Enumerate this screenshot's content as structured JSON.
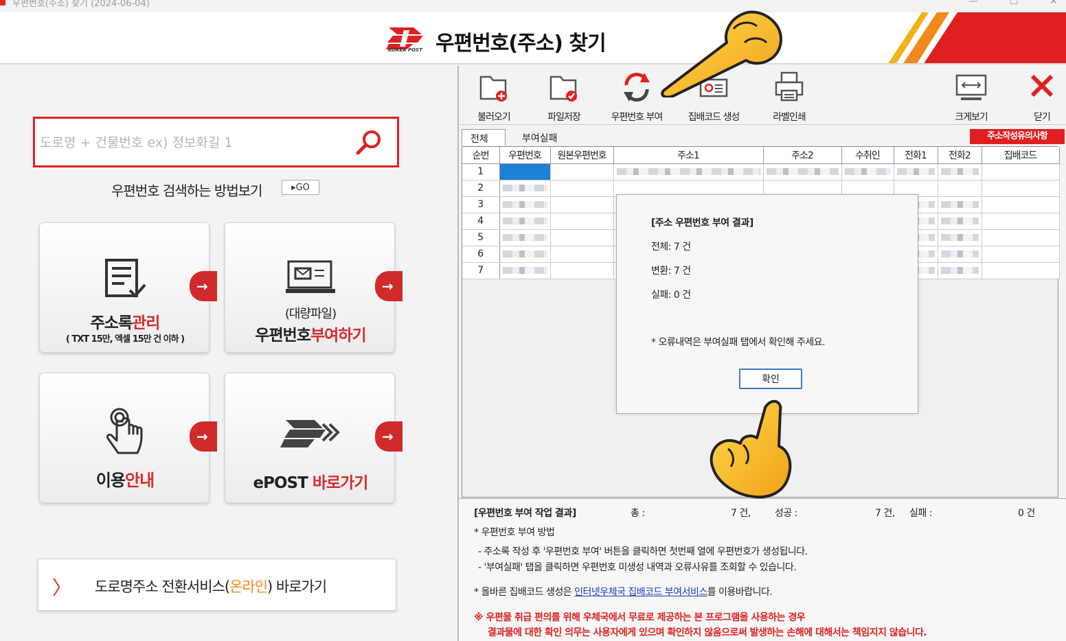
{
  "window": {
    "title": "우편번호(주소) 찾기 (2024-06-04)",
    "min": "—",
    "max": "☐",
    "close": "✕"
  },
  "header": {
    "logo_text": "KOREA POST",
    "title": "우편번호(주소) 찾기"
  },
  "search": {
    "placeholder": "도로명 + 건물번호 ex) 정보화길 1",
    "howto": "우편번호 검색하는 방법보기",
    "go": "▸GO"
  },
  "cards": [
    {
      "label_a": "주소록",
      "label_b": "관리",
      "sub": "( TXT 15만, 엑셀 15만 건 이하 )"
    },
    {
      "sub_top": "(대량파일)",
      "label_a": "우편번호",
      "label_b": "부여하기"
    },
    {
      "label_a": "이용",
      "label_b": "안내"
    },
    {
      "label_a": "ePOST ",
      "label_b": "바로가기"
    }
  ],
  "online": {
    "chevron": "〉",
    "text_a": "도로명주소 전환서비스(",
    "text_b": "온라인",
    "text_c": ") 바로가기"
  },
  "toolbar": {
    "load": "불러오기",
    "save": "파일저장",
    "assign": "우편번호 부여",
    "barcode": "집배코드 생성",
    "print": "라벨인쇄",
    "zoom": "크게보기",
    "close": "닫기"
  },
  "tabs": {
    "all": "전체",
    "failed": "부여실패"
  },
  "notice": "주소작성유의사항",
  "table": {
    "headers": [
      "순번",
      "우편번호",
      "원본우편번호",
      "주소1",
      "주소2",
      "수취인",
      "전화1",
      "전화2",
      "집배코드"
    ],
    "rows": [
      "1",
      "2",
      "3",
      "4",
      "5",
      "6",
      "7"
    ]
  },
  "dialog": {
    "title": "[주소 우편번호 부여 결과]",
    "total": "전체: 7 건",
    "converted": "변환: 7 건",
    "failed": "실패: 0 건",
    "note": "* 오류내역은 부여실패 탭에서 확인해 주세요.",
    "ok": "확인"
  },
  "result": {
    "heading": "[우편번호 부여 작업 결과]",
    "total_label": "총 :",
    "total_value": "7 건,",
    "success_label": "성공 :",
    "success_value": "7 건,",
    "fail_label": "실패 :",
    "fail_value": "0 건",
    "method_title": "* 우편번호 부여 방법",
    "method_1": "- 주소록 작성 후 '우편번호 부여' 버튼을 클릭하면 첫번째 열에 우편번호가 생성됩니다.",
    "method_2": "- '부여실패' 탭을 클릭하면 우편번호 미생성 내역과 오류사유를 조회할 수 있습니다.",
    "barcode_a": "* 올바른 집배코드 생성은 ",
    "barcode_link": "인터넷우체국 집배코드 부여서비스",
    "barcode_b": "를 이용바랍니다.",
    "warn_1": "※ 우편물 취급 편의를 위해 우체국에서 무료로 제공하는 본 프로그램을 사용하는 경우",
    "warn_2": "결과물에 대한 확인 의무는 사용자에게 있으며 확인하지 않음으로써 발생하는 손해에 대해서는 책임지지 않습니다."
  },
  "colors": {
    "accent": "#d92b2b",
    "link": "#1a3fb5",
    "selection": "#1e7fd6"
  }
}
